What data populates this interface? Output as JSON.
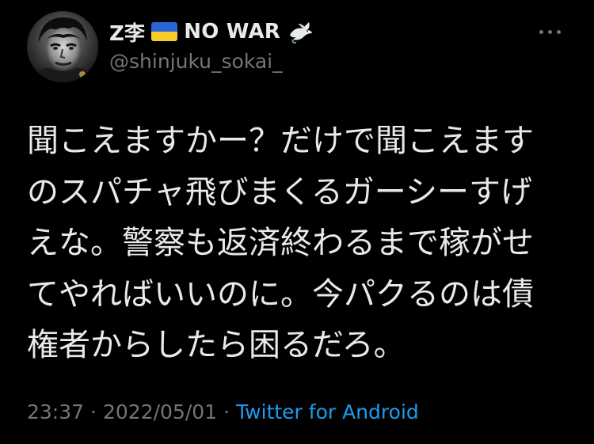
{
  "user": {
    "display_name_prefix": "Z李",
    "display_name_suffix": "NO WAR",
    "handle": "@shinjuku_sokai_",
    "flag_icon": "ukraine-flag",
    "dove_icon": "dove",
    "flag_colors": {
      "top": "#2b66d6",
      "bottom": "#f5cc2b"
    }
  },
  "menu": {
    "icon": "more-horizontal"
  },
  "tweet": {
    "lines": [
      "聞こえますかー？だけで聞こえます",
      "のスパチャ飛びまくるガーシーすげ",
      "えな。警察も返済終わるまで稼がせ",
      "てやればいいのに。今パクるのは債",
      "権者からしたら困るだろ。"
    ]
  },
  "meta": {
    "time": "23:37",
    "separator": "·",
    "date": "2022/05/01",
    "source": "Twitter for Android",
    "source_color": "#1d9bf0"
  },
  "colors": {
    "background": "#000000",
    "text": "#e7e9ea",
    "secondary": "#71767b",
    "link": "#1d9bf0"
  }
}
